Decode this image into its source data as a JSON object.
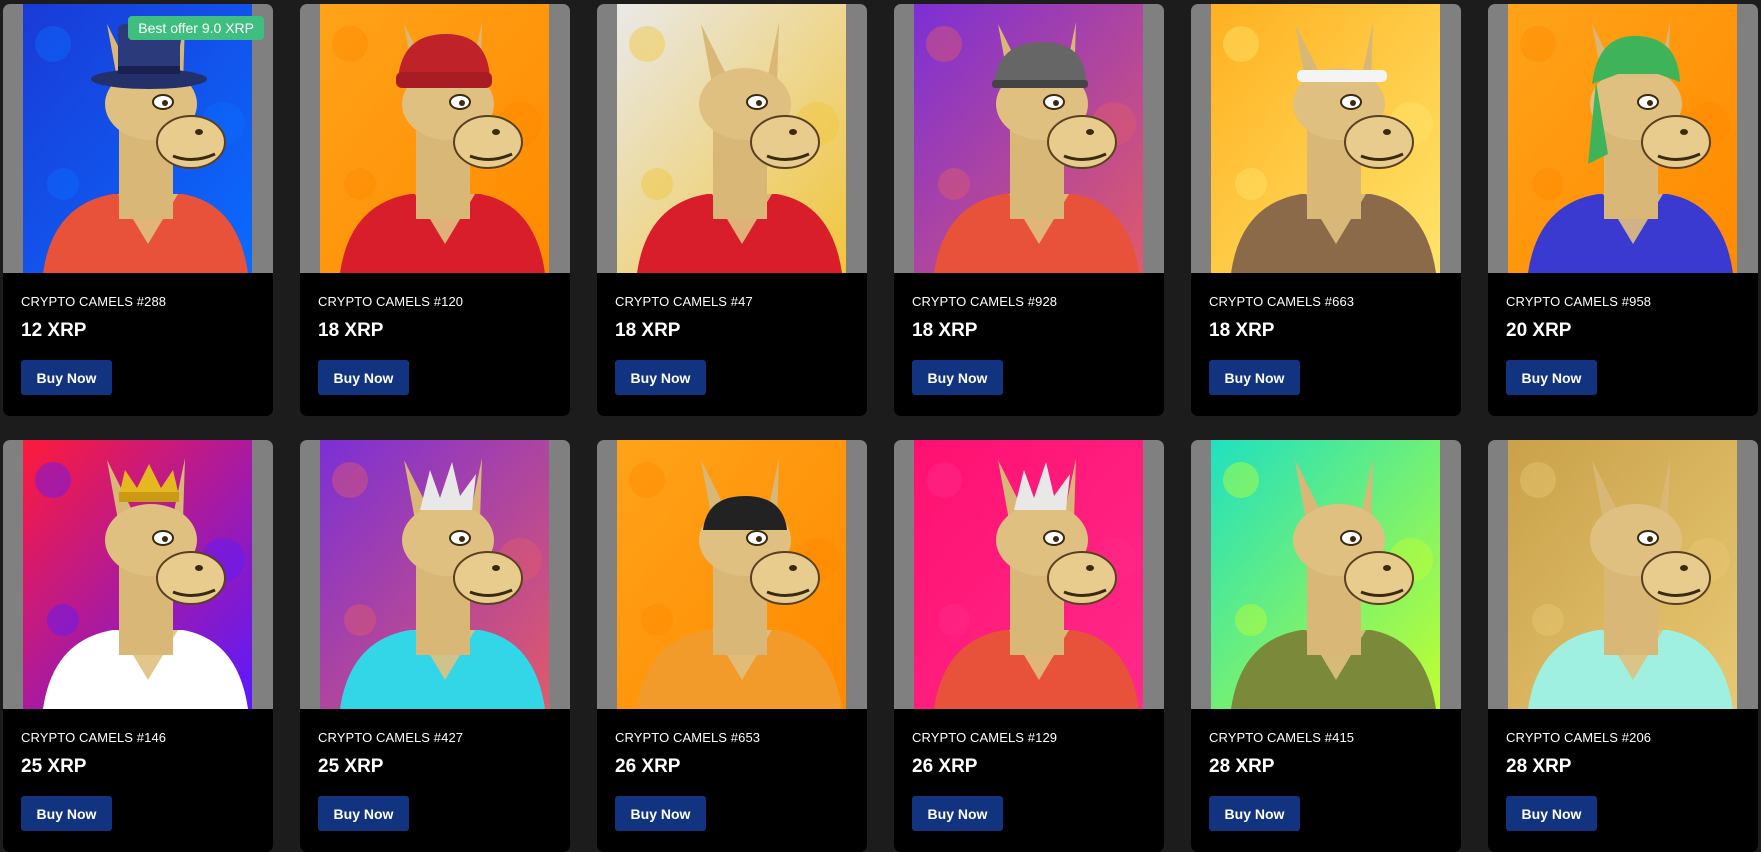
{
  "listings": [
    {
      "name": "CRYPTO CAMELS #288",
      "price": "12 XRP",
      "buy_label": "Buy Now",
      "offer": "Best offer 9.0 XRP",
      "bg": "#1a3ad6",
      "bg2": "#0a6bff",
      "hat": "tophat",
      "accent": "#e8523a"
    },
    {
      "name": "CRYPTO CAMELS #120",
      "price": "18 XRP",
      "buy_label": "Buy Now",
      "bg": "#ffa319",
      "bg2": "#ff8a00",
      "hat": "beanie",
      "accent": "#d81e2a"
    },
    {
      "name": "CRYPTO CAMELS #47",
      "price": "18 XRP",
      "buy_label": "Buy Now",
      "bg": "#e9e9e9",
      "bg2": "#f2c53a",
      "hat": "none",
      "accent": "#d81e2a"
    },
    {
      "name": "CRYPTO CAMELS #928",
      "price": "18 XRP",
      "buy_label": "Buy Now",
      "bg": "#7b2fd6",
      "bg2": "#e05a6a",
      "hat": "helmet",
      "accent": "#e8523a"
    },
    {
      "name": "CRYPTO CAMELS #663",
      "price": "18 XRP",
      "buy_label": "Buy Now",
      "bg": "#ffb020",
      "bg2": "#ffe46a",
      "hat": "headband",
      "accent": "#8b6a4a"
    },
    {
      "name": "CRYPTO CAMELS #958",
      "price": "20 XRP",
      "buy_label": "Buy Now",
      "bg": "#ffa319",
      "bg2": "#ff8a00",
      "hat": "bandana",
      "accent": "#3a3ad0"
    },
    {
      "name": "CRYPTO CAMELS #146",
      "price": "25 XRP",
      "buy_label": "Buy Now",
      "bg": "#ff1a3a",
      "bg2": "#5a1aff",
      "hat": "crown",
      "accent": "#ffffff"
    },
    {
      "name": "CRYPTO CAMELS #427",
      "price": "25 XRP",
      "buy_label": "Buy Now",
      "bg": "#7b2fd6",
      "bg2": "#e05a6a",
      "hat": "spiky",
      "accent": "#33d6e6"
    },
    {
      "name": "CRYPTO CAMELS #653",
      "price": "26 XRP",
      "buy_label": "Buy Now",
      "bg": "#ffa319",
      "bg2": "#ff8a00",
      "hat": "goggles",
      "accent": "#f29a2a"
    },
    {
      "name": "CRYPTO CAMELS #129",
      "price": "26 XRP",
      "buy_label": "Buy Now",
      "bg": "#ff1070",
      "bg2": "#ff2a8a",
      "hat": "spiky",
      "accent": "#e8523a"
    },
    {
      "name": "CRYPTO CAMELS #415",
      "price": "28 XRP",
      "buy_label": "Buy Now",
      "bg": "#20e0c0",
      "bg2": "#c0ff30",
      "hat": "none",
      "accent": "#7a8a3a"
    },
    {
      "name": "CRYPTO CAMELS #206",
      "price": "28 XRP",
      "buy_label": "Buy Now",
      "bg": "#c9a14a",
      "bg2": "#e8c873",
      "hat": "none",
      "accent": "#9ff0e0"
    }
  ]
}
